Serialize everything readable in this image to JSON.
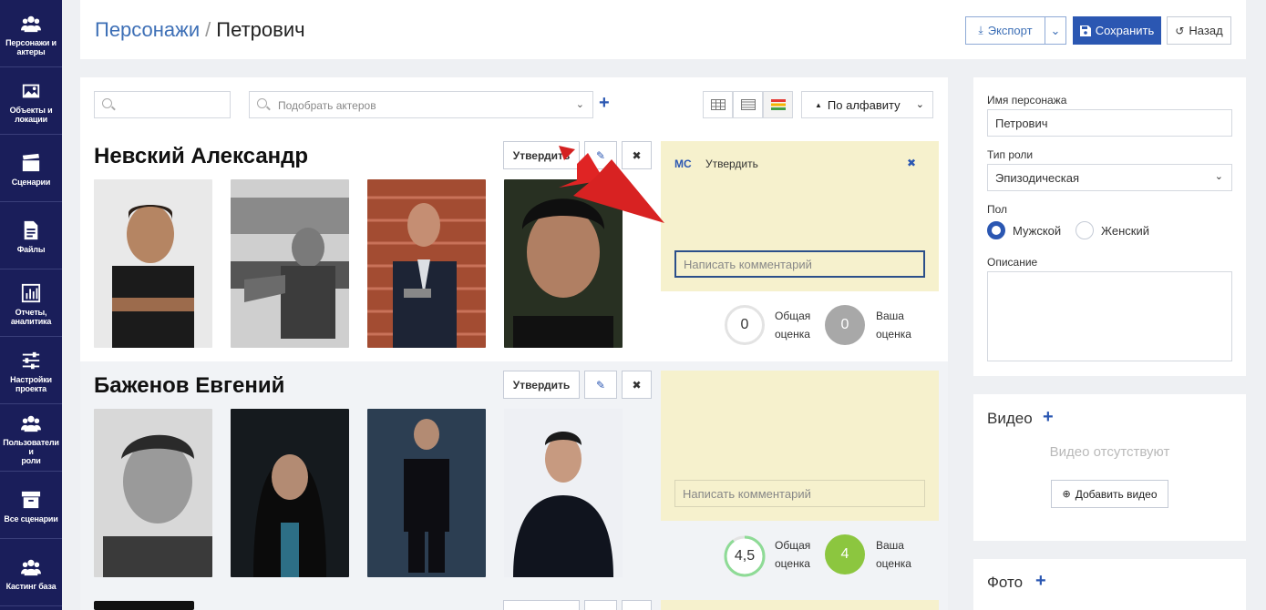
{
  "sidebar": {
    "items": [
      {
        "label": "Персонажи и\nактеры",
        "icon": "users-icon"
      },
      {
        "label": "Объекты и\nлокации",
        "icon": "image-icon"
      },
      {
        "label": "Сценарии",
        "icon": "clapperboard-icon"
      },
      {
        "label": "Файлы",
        "icon": "file-icon"
      },
      {
        "label": "Отчеты,\nаналитика",
        "icon": "chart-icon"
      },
      {
        "label": "Настройки\nпроекта",
        "icon": "sliders-icon"
      },
      {
        "label": "Пользователи и\nроли",
        "icon": "users-icon"
      },
      {
        "label": "Все сценарии",
        "icon": "archive-icon"
      },
      {
        "label": "Кастинг база",
        "icon": "users-icon"
      }
    ]
  },
  "header": {
    "breadcrumb_link": "Персонажи",
    "breadcrumb_sep": "/",
    "breadcrumb_current": "Петрович",
    "export_label": "Экспорт",
    "save_label": "Сохранить",
    "back_label": "Назад"
  },
  "toolbar": {
    "search_value": "",
    "pick_placeholder": "Подобрать актеров",
    "sort_label": "По алфавиту"
  },
  "actors": [
    {
      "name": "Невский Александр",
      "approve_label": "Утвердить",
      "comment_author": "MC",
      "comment_text": "Утвердить",
      "comment_placeholder": "Написать комментарий",
      "overall_score": "0",
      "your_score": "0"
    },
    {
      "name": "Баженов Евгений",
      "approve_label": "Утвердить",
      "comment_placeholder": "Написать комментарий",
      "overall_score": "4,5",
      "your_score": "4"
    }
  ],
  "score_labels": {
    "overall": "Общая\nоценка",
    "yours": "Ваша\nоценка"
  },
  "character": {
    "name_label": "Имя персонажа",
    "name_value": "Петрович",
    "role_label": "Тип роли",
    "role_value": "Эпизодическая",
    "gender_label": "Пол",
    "gender_male": "Мужской",
    "gender_female": "Женский",
    "description_label": "Описание"
  },
  "video": {
    "title": "Видео",
    "empty_text": "Видео отсутствуют",
    "add_label": "Добавить видео"
  },
  "photo": {
    "title": "Фото"
  },
  "colors": {
    "sidebar": "#1a1e5a",
    "accent": "#2b57b2",
    "comment_bg": "#f6f1cd",
    "score_gray": "#a8a8a8",
    "score_green": "#8cc63f"
  }
}
